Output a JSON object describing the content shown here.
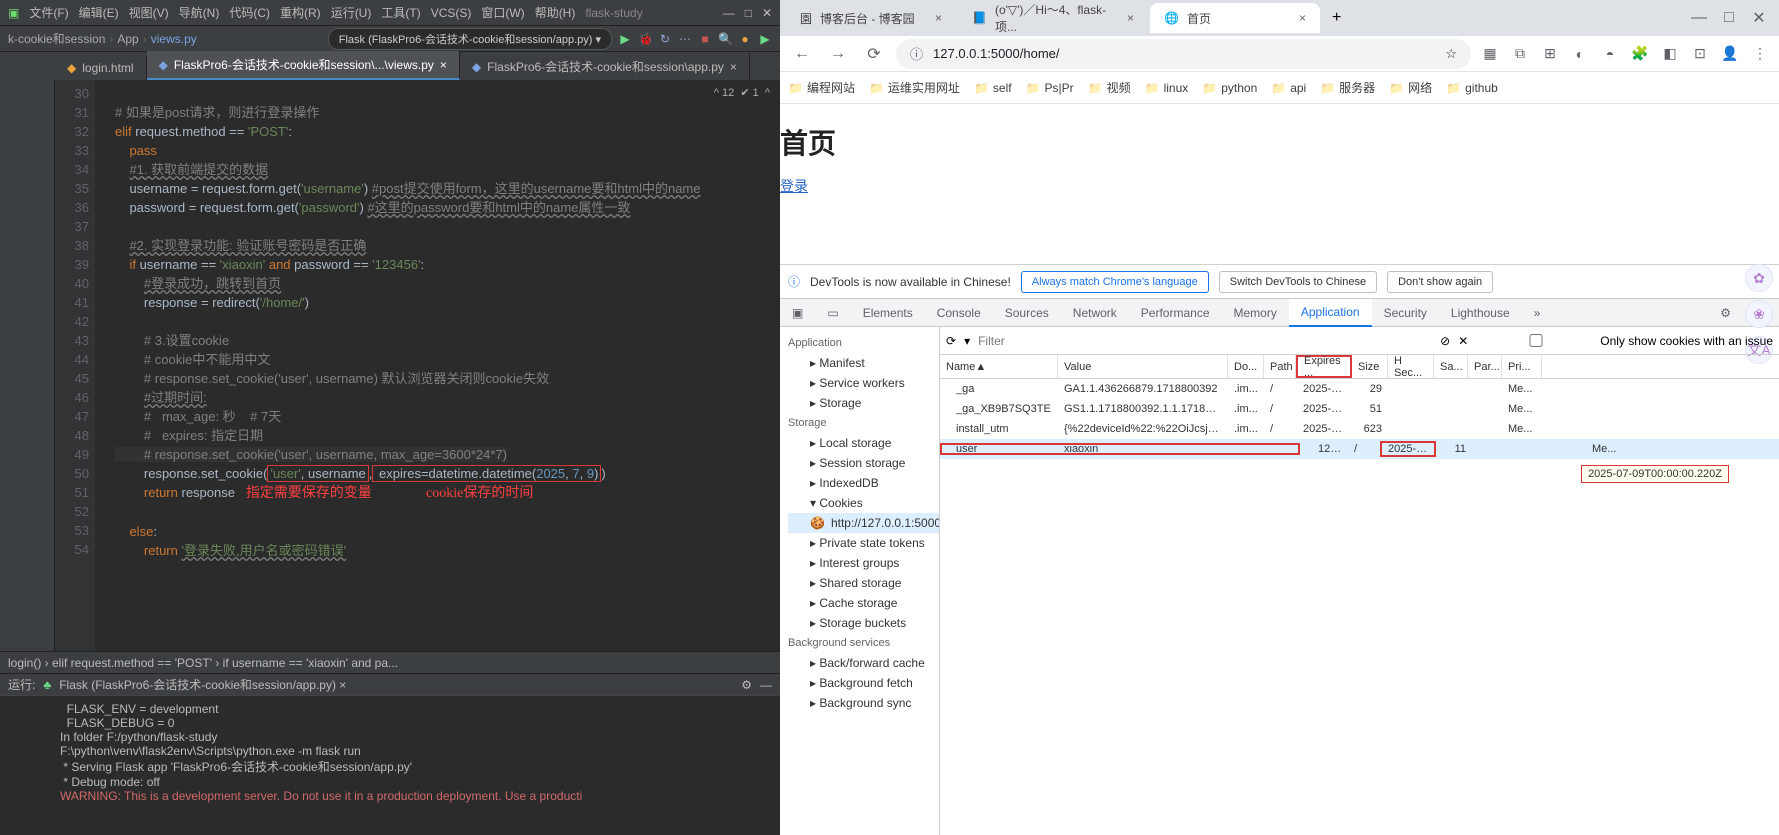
{
  "ide": {
    "menu": [
      "文件(F)",
      "编辑(E)",
      "视图(V)",
      "导航(N)",
      "代码(C)",
      "重构(R)",
      "运行(U)",
      "工具(T)",
      "VCS(S)",
      "窗口(W)",
      "帮助(H)",
      "flask-study"
    ],
    "breadcrumb": [
      "k-cookie和session",
      "App",
      "views.py"
    ],
    "run_config": "Flask (FlaskPro6-会话技术-cookie和session/app.py) ▾",
    "tabs": [
      {
        "label": "login.html",
        "active": false
      },
      {
        "label": "FlaskPro6-会话技术-cookie和session\\...\\views.py",
        "active": true
      },
      {
        "label": "FlaskPro6-会话技术-cookie和session\\app.py",
        "active": false
      }
    ],
    "hints": "^ 12  ✔ 1  ^",
    "annot1": "指定需要保存的变量",
    "annot2": "cookie保存的时间",
    "status_path": "login()   ›   elif request.method == 'POST'   ›   if username == 'xiaoxin' and pa...",
    "run_label": "运行:",
    "run_target": "Flask (FlaskPro6-会话技术-cookie和session/app.py) ×",
    "terminal": "  FLASK_ENV = development\n  FLASK_DEBUG = 0\nIn folder F:/python/flask-study\nF:\\python\\venv\\flask2env\\Scripts\\python.exe -m flask run\n * Serving Flask app 'FlaskPro6-会话技术-cookie和session/app.py'\n * Debug mode: off",
    "terminal_warn": "WARNING: This is a development server. Do not use it in a production deployment. Use a producti",
    "lines": [
      30,
      31,
      32,
      33,
      34,
      35,
      36,
      37,
      38,
      39,
      40,
      41,
      42,
      43,
      44,
      45,
      46,
      47,
      48,
      49,
      50,
      51,
      52,
      53,
      54
    ]
  },
  "browser": {
    "tabs": [
      {
        "label": "博客后台 - 博客园",
        "active": false
      },
      {
        "label": "(o'▽')／Hi～4、flask-项...",
        "active": false
      },
      {
        "label": "首页",
        "active": true
      }
    ],
    "url": "127.0.0.1:5000/home/",
    "bookmarks": [
      "编程网站",
      "运维实用网址",
      "self",
      "Ps|Pr",
      "视频",
      "linux",
      "python",
      "api",
      "服务器",
      "网络",
      "github"
    ],
    "page": {
      "title": "首页",
      "link": "登录"
    }
  },
  "devtools": {
    "banner": "DevTools is now available in Chinese!",
    "banner_btns": [
      "Always match Chrome's language",
      "Switch DevTools to Chinese",
      "Don't show again"
    ],
    "tabs": [
      "Elements",
      "Console",
      "Sources",
      "Network",
      "Performance",
      "Memory",
      "Application",
      "Security",
      "Lighthouse"
    ],
    "active_tab": "Application",
    "side": {
      "app_header": "Application",
      "app": [
        "Manifest",
        "Service workers",
        "Storage"
      ],
      "storage_header": "Storage",
      "storage": [
        "Local storage",
        "Session storage",
        "IndexedDB",
        "Cookies"
      ],
      "cookie_sub": "http://127.0.0.1:5000",
      "storage2": [
        "Private state tokens",
        "Interest groups",
        "Shared storage",
        "Cache storage",
        "Storage buckets"
      ],
      "bg_header": "Background services",
      "bg": [
        "Back/forward cache",
        "Background fetch",
        "Background sync"
      ]
    },
    "filter_placeholder": "Filter",
    "only_issue": "Only show cookies with an issue",
    "cols": [
      "Name",
      "Value",
      "Do...",
      "Path",
      "Expires ...",
      "Size",
      "H Sec...",
      "Sa...",
      "Par...",
      "Pri..."
    ],
    "rows": [
      {
        "name": "_ga",
        "value": "GA1.1.436266879.1718800392",
        "dom": ".im...",
        "path": "/",
        "exp": "2025-0...",
        "size": "29",
        "pri": "Me..."
      },
      {
        "name": "_ga_XB9B7SQ3TE",
        "value": "GS1.1.1718800392.1.1.171880...",
        "dom": ".im...",
        "path": "/",
        "exp": "2025-0...",
        "size": "51",
        "pri": "Me..."
      },
      {
        "name": "install_utm",
        "value": "{%22deviceId%22:%22OiJcsjV...",
        "dom": ".im...",
        "path": "/",
        "exp": "2025-0...",
        "size": "623",
        "pri": "Me..."
      },
      {
        "name": "user",
        "value": "xiaoxin",
        "dom": "127...",
        "path": "/",
        "exp": "2025-0...",
        "size": "11",
        "pri": "Me...",
        "sel": true
      }
    ],
    "tooltip": "2025-07-09T00:00:00.220Z"
  }
}
